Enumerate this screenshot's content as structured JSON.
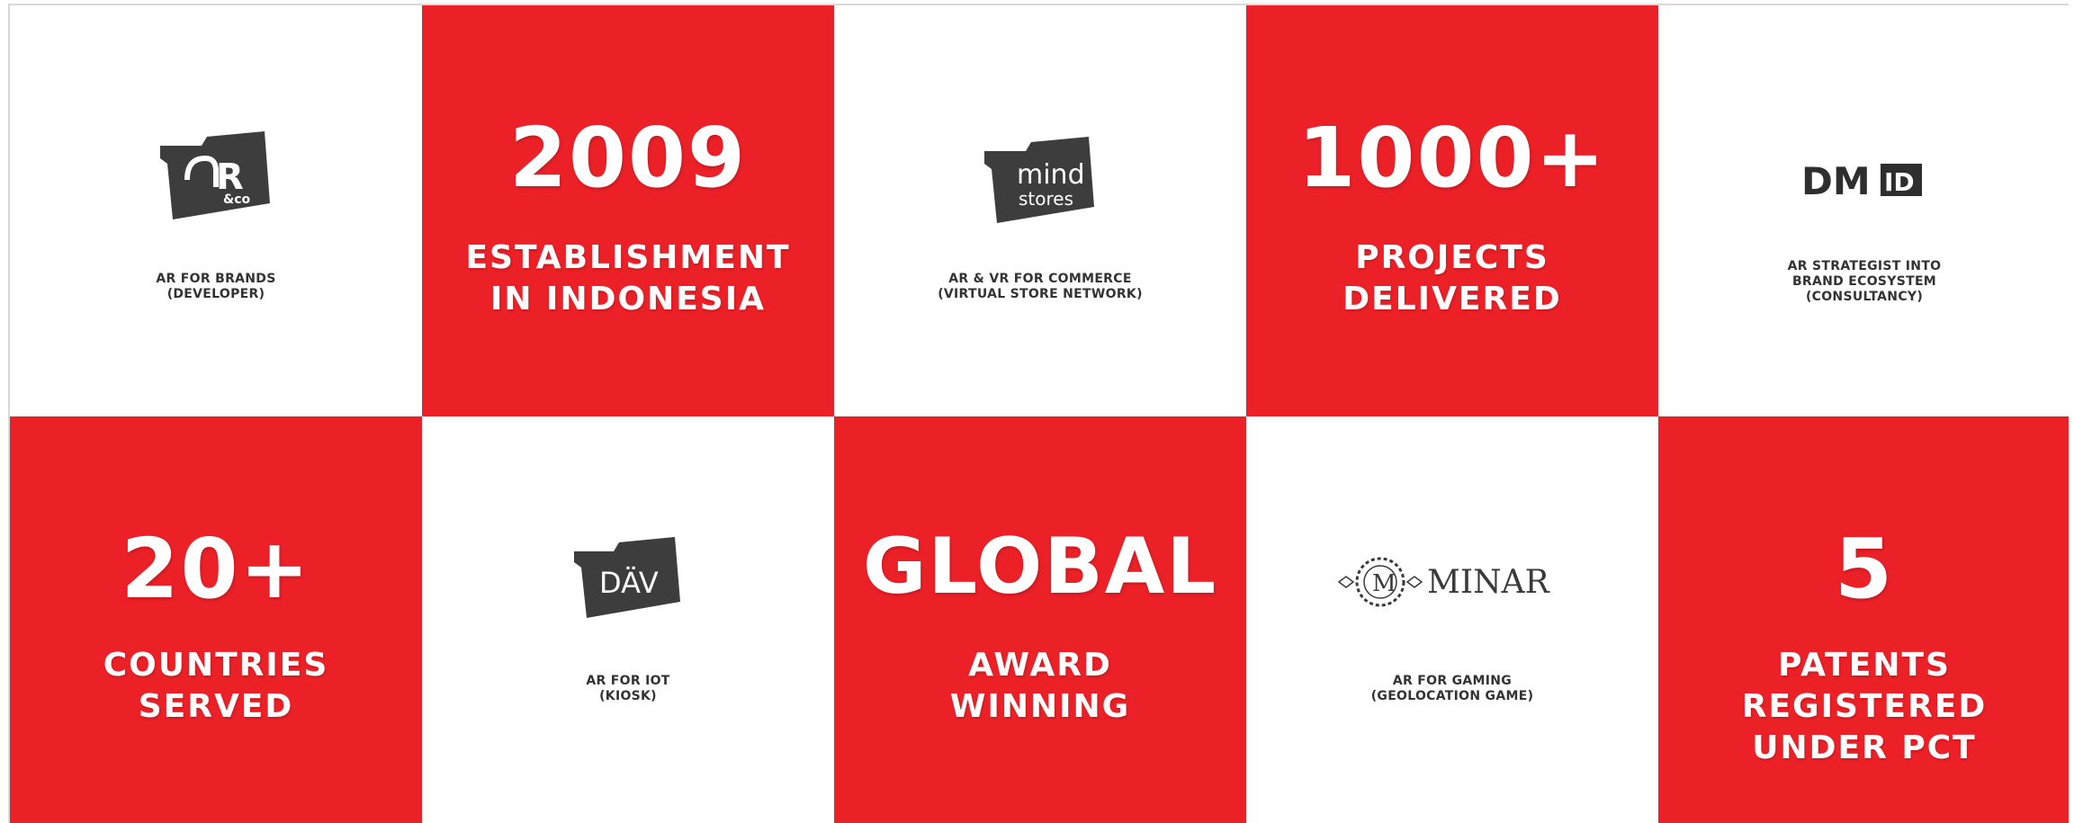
{
  "colors": {
    "red": "#ec2027",
    "dark": "#333333",
    "white": "#ffffff"
  },
  "cells": {
    "arco": {
      "logo": {
        "icon": "ar-co-logo-icon",
        "text": "R",
        "subtext": "&co"
      },
      "label": [
        "AR FOR BRANDS",
        "(DEVELOPER)"
      ]
    },
    "est": {
      "big": "2009",
      "sub": [
        "ESTABLISHMENT",
        "IN INDONESIA"
      ]
    },
    "mind": {
      "logo": {
        "icon": "mind-stores-logo-icon",
        "line1": "mind",
        "line2": "stores"
      },
      "label": [
        "AR & VR FOR COMMERCE",
        "(VIRTUAL STORE NETWORK)"
      ]
    },
    "projects": {
      "big": "1000+",
      "sub": [
        "PROJECTS",
        "DELIVERED"
      ]
    },
    "dmid": {
      "logo": {
        "icon": "dmid-logo-icon",
        "text": "DM",
        "box": "ID"
      },
      "label": [
        "AR STRATEGIST INTO",
        "BRAND ECOSYSTEM",
        "(CONSULTANCY)"
      ]
    },
    "countries": {
      "big": "20+",
      "sub": [
        "COUNTRIES",
        "SERVED"
      ]
    },
    "dav": {
      "logo": {
        "icon": "dav-logo-icon",
        "text": "DÄV"
      },
      "label": [
        "AR FOR IOT",
        "(KIOSK)"
      ]
    },
    "global": {
      "big": "GLOBAL",
      "sub": [
        "AWARD",
        "WINNING"
      ]
    },
    "minar": {
      "logo": {
        "icon": "minar-logo-icon",
        "emblem": "M",
        "text": "MINAR"
      },
      "label": [
        "AR FOR GAMING",
        "(GEOLOCATION GAME)"
      ]
    },
    "patents": {
      "big": "5",
      "sub": [
        "PATENTS",
        "REGISTERED",
        "UNDER PCT"
      ]
    }
  }
}
